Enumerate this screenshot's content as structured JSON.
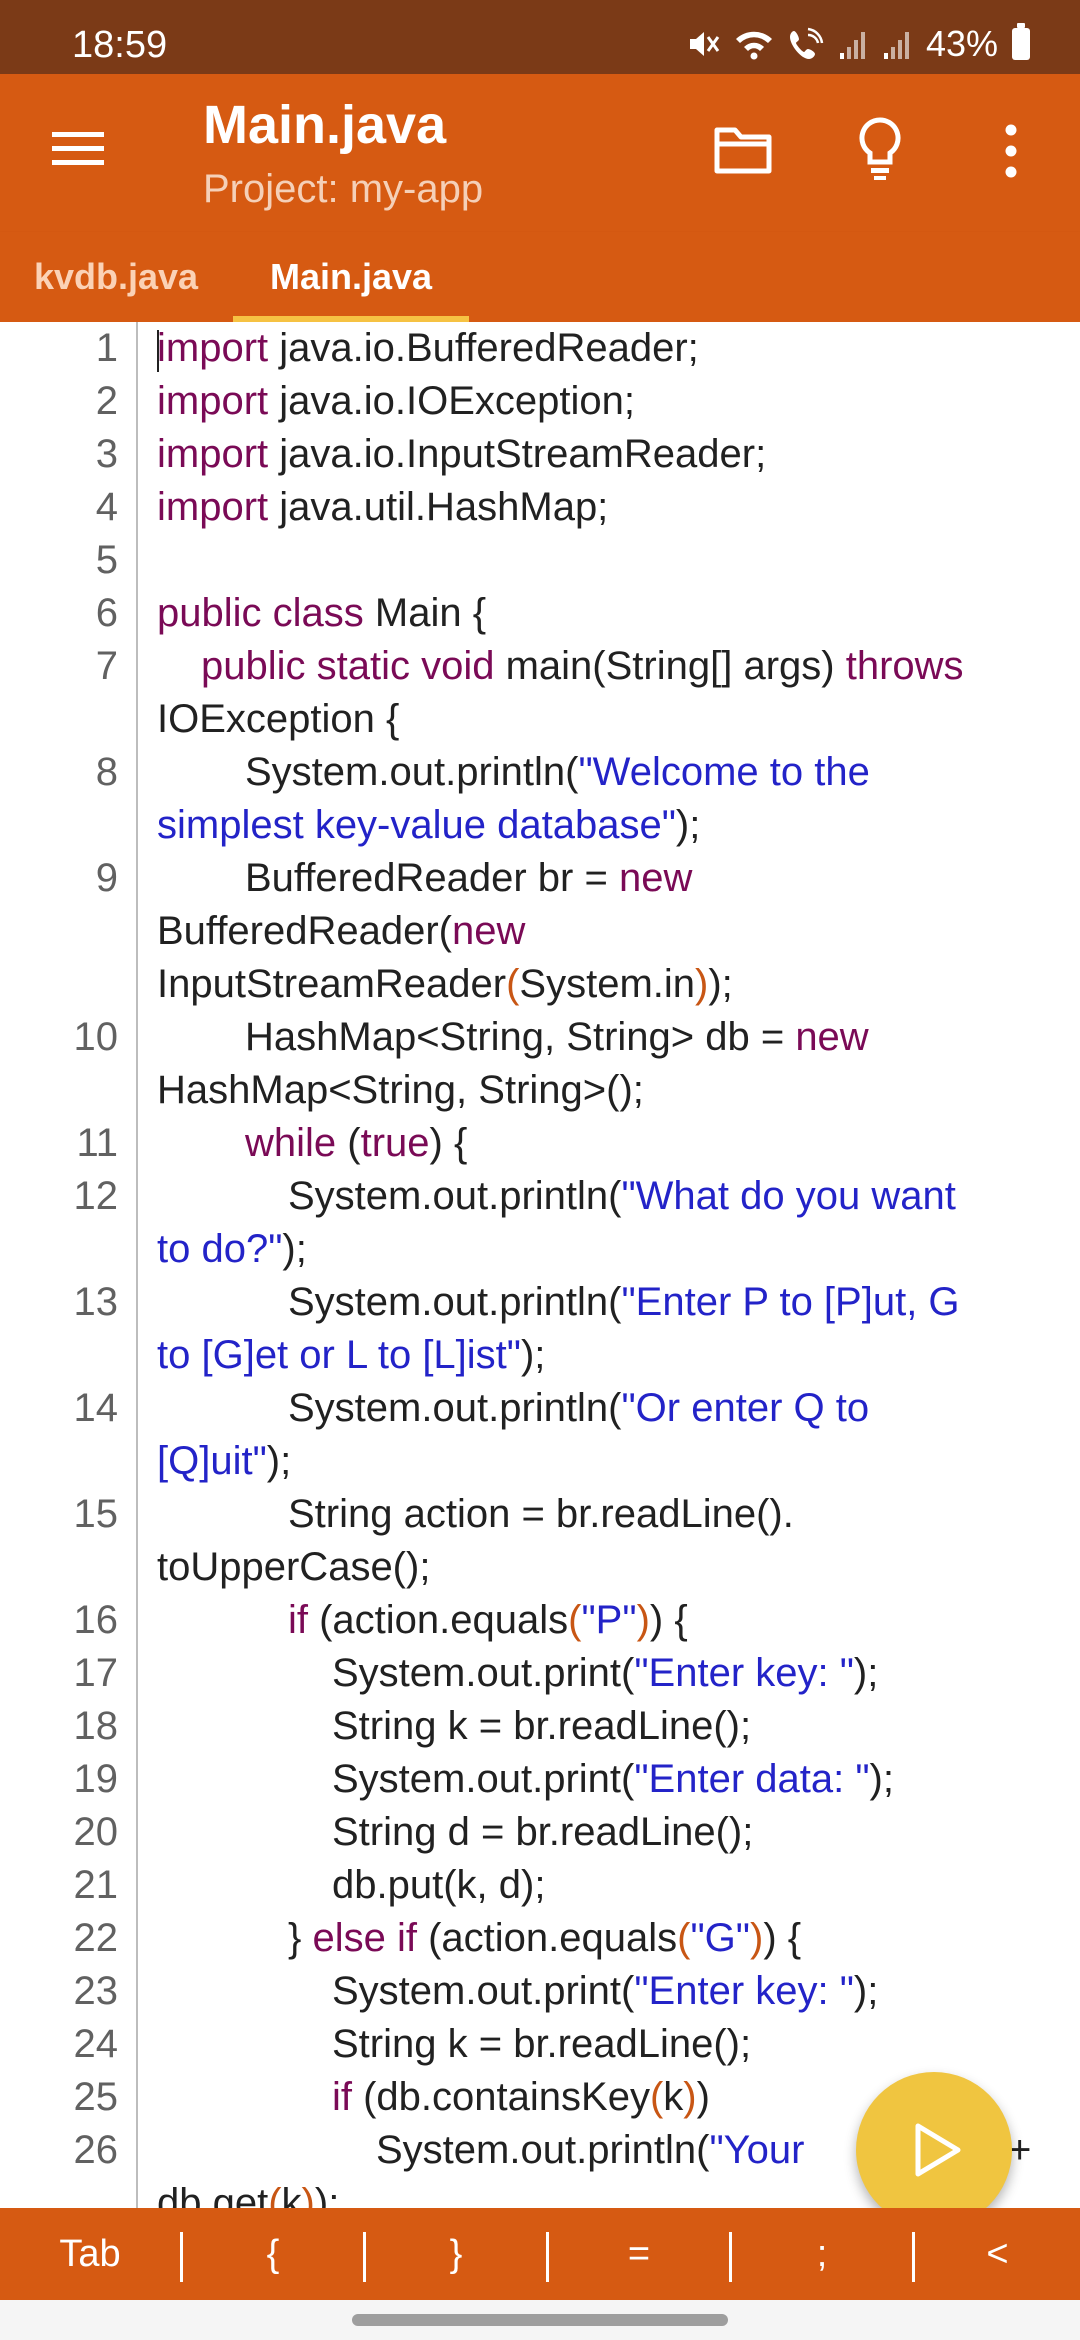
{
  "status_bar": {
    "time": "18:59",
    "battery_percent": "43%",
    "icons": [
      "mute-icon",
      "wifi-icon",
      "wifi-calling-icon",
      "signal-icon-1",
      "signal-icon-2",
      "battery-icon"
    ]
  },
  "app_bar": {
    "title": "Main.java",
    "subtitle": "Project: my-app",
    "icons": [
      "menu-icon",
      "folder-icon",
      "lightbulb-icon",
      "more-vert-icon"
    ]
  },
  "tabs": [
    {
      "label": "kvdb.java",
      "active": false
    },
    {
      "label": "Main.java",
      "active": true
    }
  ],
  "colors": {
    "status_bar": "#7b3a17",
    "app_bar": "#d65a12",
    "tab_indicator": "#f6c243",
    "keyword": "#7a0a56",
    "string": "#2323c8",
    "fab": "#f0c540"
  },
  "editor": {
    "line_numbers": [
      "1",
      "2",
      "3",
      "4",
      "5",
      "6",
      "7",
      "8",
      "9",
      "10",
      "11",
      "12",
      "13",
      "14",
      "15",
      "16",
      "17",
      "18",
      "19",
      "20",
      "21",
      "22",
      "23",
      "24",
      "25",
      "26"
    ],
    "code": {
      "r1_kw": "import",
      "r1_t": " java.io.BufferedReader;",
      "r2_kw": "import",
      "r2_t": " java.io.IOException;",
      "r3_kw": "import",
      "r3_t": " java.io.InputStreamReader;",
      "r4_kw": "import",
      "r4_t": " java.util.HashMap;",
      "r6_kw": "public class",
      "r6_t": " Main {",
      "r7_kw": "public static void",
      "r7_t1": " main(String[] args) ",
      "r7_kw2": "throws",
      "r8_t": "IOException {",
      "r9_t": "System.out.println(",
      "r9_s": "\"Welcome to the",
      "r10_s": "simplest key-value database\"",
      "r10_t": ");",
      "r11_t": "BufferedReader br = ",
      "r11_kw": "new",
      "r12_t": "BufferedReader(",
      "r12_kw": "new",
      "r13_t1": "InputStreamReader",
      "r13_b1": "(",
      "r13_t2": "System.in",
      "r13_b2": ")",
      "r13_t3": ");",
      "r14_t": "HashMap<String, String> db = ",
      "r14_kw": "new",
      "r15_t": "HashMap<String, String>();",
      "r16_kw1": "while",
      "r16_t1": " (",
      "r16_kw2": "true",
      "r16_t2": ") {",
      "r17_t": "System.out.println(",
      "r17_s": "\"What do you want",
      "r18_s": "to do?\"",
      "r18_t": ");",
      "r19_t": "System.out.println(",
      "r19_s": "\"Enter P to [P]ut, G",
      "r20_s": "to [G]et or L to [L]ist\"",
      "r20_t": ");",
      "r21_t": "System.out.println(",
      "r21_s": "\"Or enter Q to",
      "r22_s": "[Q]uit\"",
      "r22_t": ");",
      "r23_t": "String action = br.readLine().",
      "r24_t": "toUpperCase();",
      "r25_kw": "if",
      "r25_t1": " (action.equals",
      "r25_b1": "(",
      "r25_s": "\"P\"",
      "r25_b2": ")",
      "r25_t2": ") {",
      "r26_t": "System.out.print(",
      "r26_s": "\"Enter key: \"",
      "r26_t2": ");",
      "r27_t": "String k = br.readLine();",
      "r28_t": "System.out.print(",
      "r28_s": "\"Enter data: \"",
      "r28_t2": ");",
      "r29_t": "String d = br.readLine();",
      "r30_t": "db.put(k, d);",
      "r31_t1": "} ",
      "r31_kw": "else if",
      "r31_t2": " (action.equals",
      "r31_b1": "(",
      "r31_s": "\"G\"",
      "r31_b2": ")",
      "r31_t3": ") {",
      "r32_t": "System.out.print(",
      "r32_s": "\"Enter key: \"",
      "r32_t2": ");",
      "r33_t": "String k = br.readLine();",
      "r34_kw": "if",
      "r34_t1": " (db.containsKey",
      "r34_b1": "(",
      "r34_t2": "k",
      "r34_b2": ")",
      "r34_t3": ")",
      "r35_t": "System.out.println(",
      "r35_s": "\"Your",
      "r35_t2": "+",
      "r36_t1": "db.get",
      "r36_b1": "(",
      "r36_t2": "k",
      "r36_b2": ")",
      "r36_t3": ");"
    }
  },
  "fab": {
    "icon": "play-icon"
  },
  "key_bar": {
    "keys": [
      "Tab",
      "{",
      "}",
      "=",
      ";",
      "<"
    ]
  }
}
